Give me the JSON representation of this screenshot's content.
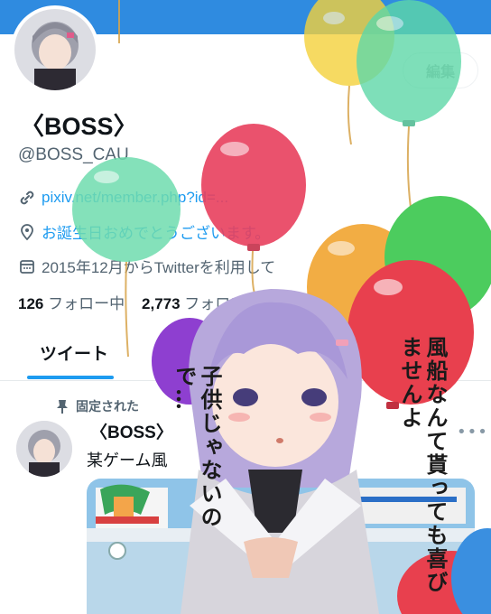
{
  "header": {
    "banner_color": "#2f8be0"
  },
  "profile": {
    "edit_button_label": "編集",
    "display_name": "〈BOSS〉",
    "handle": "@BOSS_CAU",
    "link_text": "pixiv.net/member.php?id=...",
    "bio_text": "お誕生日おめでとうございます。",
    "joined_text": "2015年12月からTwitterを利用して",
    "following_count": "126",
    "following_label": "フォロー中",
    "followers_count": "2,773",
    "followers_label": "フォロワ"
  },
  "tabs": {
    "active": "ツイート"
  },
  "pinned_tweet": {
    "pinned_label": "固定された",
    "author_name": "〈BOSS〉",
    "text": "某ゲーム風",
    "more_icon": "more-dots-icon"
  },
  "overlay": {
    "speech_right": "風船なんて貰っても喜びませんよ",
    "speech_left": "子供じゃないので…",
    "balloon_colors": [
      "#f4d23c",
      "#5ed8a8",
      "#e8405e",
      "#6fdcae",
      "#f2a93a",
      "#4ccc5e",
      "#e8404e",
      "#8e3fd0"
    ]
  },
  "icons": [
    "link-icon",
    "location-icon",
    "calendar-icon",
    "pin-icon"
  ]
}
